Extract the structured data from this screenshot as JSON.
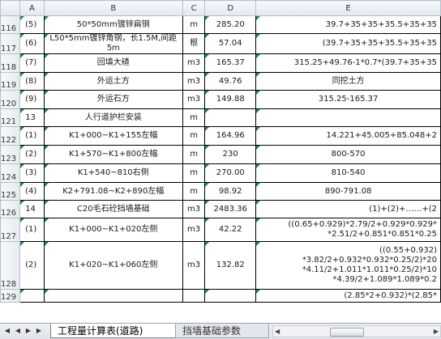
{
  "columns": [
    "A",
    "B",
    "C",
    "D",
    "E"
  ],
  "rows": [
    {
      "num": "116",
      "a": "(5)",
      "b": [
        "50*50mm镀锌扁钢"
      ],
      "c": "m",
      "d": "285.20",
      "e": [
        "39.7+35+35+35.5+35+35"
      ],
      "e_align": "right"
    },
    {
      "num": "117",
      "a": "(6)",
      "b": [
        "L50*5mm镀锌角钢，长1.5M,间距",
        "5m"
      ],
      "c": "根",
      "d": "57.04",
      "e": [
        "(39.7+35+35+35.5+35+35"
      ],
      "e_align": "right"
    },
    {
      "num": "118",
      "a": "(7)",
      "b": [
        "回填大碴"
      ],
      "c": "m3",
      "d": "165.37",
      "e": [
        "315.25+49.76-1*0.7*(39.7+35+35"
      ],
      "e_align": "right"
    },
    {
      "num": "119",
      "a": "(8)",
      "b": [
        "外运土方"
      ],
      "c": "m3",
      "d": "49.76",
      "e": [
        "同挖土方"
      ],
      "e_align": "center"
    },
    {
      "num": "120",
      "a": "(9)",
      "b": [
        "外运石方"
      ],
      "c": "m3",
      "d": "149.88",
      "e": [
        "315.25-165.37"
      ],
      "e_align": "center"
    },
    {
      "num": "121",
      "a": "13",
      "b": [
        "人行道护栏安装"
      ],
      "c": "m",
      "d": "",
      "e": [
        ""
      ],
      "e_align": "center"
    },
    {
      "num": "122",
      "a": "(1)",
      "b": [
        "K1+000~K1+155左幅"
      ],
      "c": "m",
      "d": "164.96",
      "e": [
        "14.221+45.005+85.048+2"
      ],
      "e_align": "right"
    },
    {
      "num": "123",
      "a": "(2)",
      "b": [
        "K1+570~K1+800左幅"
      ],
      "c": "m",
      "d": "230",
      "e": [
        "800-570"
      ],
      "e_align": "center"
    },
    {
      "num": "124",
      "a": "(3)",
      "b": [
        "K1+540~810右侧"
      ],
      "c": "m",
      "d": "270.00",
      "e": [
        "810-540"
      ],
      "e_align": "center"
    },
    {
      "num": "125",
      "a": "(4)",
      "b": [
        "K2+791.08~K2+890左幅"
      ],
      "c": "m",
      "d": "98.92",
      "e": [
        "890-791.08"
      ],
      "e_align": "center"
    },
    {
      "num": "126",
      "a": "14",
      "b": [
        "C20毛石砼挡墙基础"
      ],
      "c": "m3",
      "d": "2483.36",
      "e": [
        "(1)+(2)+……+(2"
      ],
      "e_align": "right"
    },
    {
      "num": "127",
      "a": "(1)",
      "b": [
        "K1+000~K1+020左侧"
      ],
      "c": "m3",
      "d": "42.22",
      "e": [
        "((0.65+0.929)*2.79/2+0.929*0.929*",
        "*2.51/2+0.851*0.851*0.25"
      ],
      "e_align": "right"
    },
    {
      "num": "128",
      "a": "(2)",
      "b": [
        "K1+020~K1+060左侧"
      ],
      "c": "m3",
      "d": "132.82",
      "e": [
        "((0.55+0.932)",
        "*3.82/2+0.932*0.932*0.25/2)*20",
        "*4.11/2+1.011*1.011*0.25/2)*10",
        "*4.39/2+1.089*1.089*0.2"
      ],
      "e_align": "right"
    },
    {
      "num": "129",
      "a": "",
      "b": [
        ""
      ],
      "c": "",
      "d": "",
      "e": [
        "(2.85*2+0.932)*(2.85*"
      ],
      "e_align": "right"
    }
  ],
  "tabs": {
    "active": "工程量计算表(道路)",
    "inactive": "挡墙基础参数"
  },
  "nav": {
    "first": "◀",
    "prev": "◀",
    "next": "▶",
    "last": "▶"
  },
  "scroll": {
    "left": "◀",
    "right": "▶"
  }
}
